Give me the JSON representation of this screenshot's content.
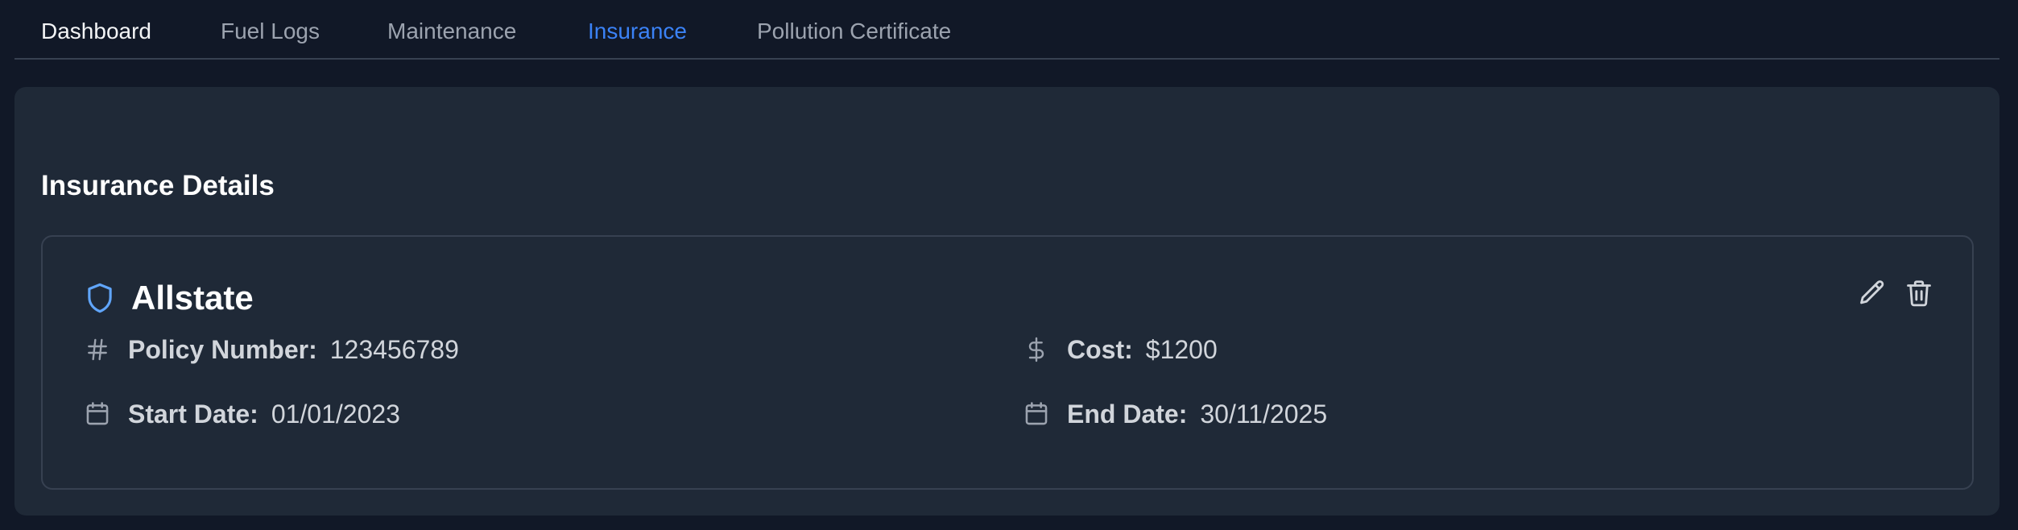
{
  "tabs": [
    {
      "label": "Dashboard"
    },
    {
      "label": "Fuel Logs"
    },
    {
      "label": "Maintenance"
    },
    {
      "label": "Insurance"
    },
    {
      "label": "Pollution Certificate"
    }
  ],
  "section": {
    "title": "Insurance Details"
  },
  "insurance": {
    "provider": "Allstate",
    "policy_number_label": "Policy Number:",
    "policy_number": "123456789",
    "cost_label": "Cost:",
    "cost": "$1200",
    "start_date_label": "Start Date:",
    "start_date": "01/01/2023",
    "end_date_label": "End Date:",
    "end_date": "30/11/2025"
  },
  "icons": {
    "provider": "shield-icon",
    "policy_number": "hash-icon",
    "cost": "dollar-icon",
    "start_date": "calendar-icon",
    "end_date": "calendar-icon",
    "edit": "pencil-icon",
    "delete": "trash-icon"
  },
  "colors": {
    "background": "#111827",
    "panel": "#1f2937",
    "border": "#374151",
    "accent": "#3b82f6",
    "muted_text": "#9ca3af",
    "text": "#d1d5db"
  }
}
